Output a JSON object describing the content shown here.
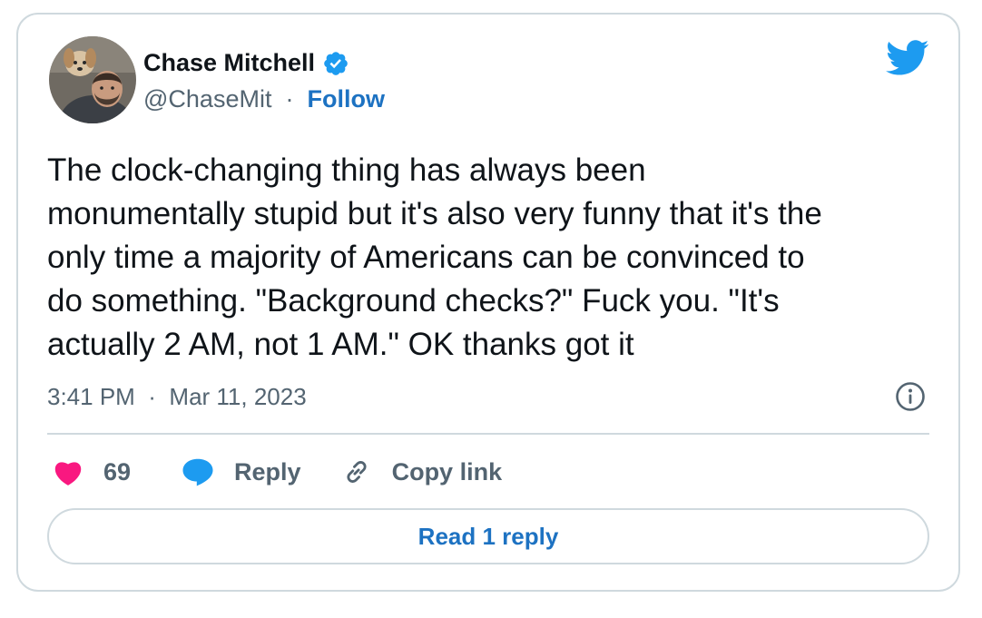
{
  "author": {
    "name": "Chase Mitchell",
    "handle": "@ChaseMit",
    "separator": "·",
    "follow_label": "Follow",
    "verified": true
  },
  "tweet": {
    "text": "The clock-changing thing has always been\nmonumentally stupid but it's also very funny that it's the\nonly time a majority of Americans can be convinced to\ndo something. \"Background checks?\" Fuck you. \"It's\nactually 2 AM, not 1 AM.\" OK thanks got it",
    "time": "3:41 PM",
    "separator": "·",
    "date": "Mar 11, 2023"
  },
  "actions": {
    "like_count": "69",
    "reply_label": "Reply",
    "copy_link_label": "Copy link"
  },
  "read_replies_label": "Read 1 reply",
  "icons": {
    "brand": "twitter-bird-icon",
    "verified": "verified-badge-icon",
    "info": "info-icon",
    "like": "heart-icon",
    "reply": "speech-bubble-icon",
    "copy": "link-icon"
  },
  "colors": {
    "brand_blue": "#1d9bf0",
    "link_blue": "#1d72c2",
    "like_pink": "#f91880",
    "text": "#0f1419",
    "muted": "#536471",
    "border": "#cfd9de"
  }
}
